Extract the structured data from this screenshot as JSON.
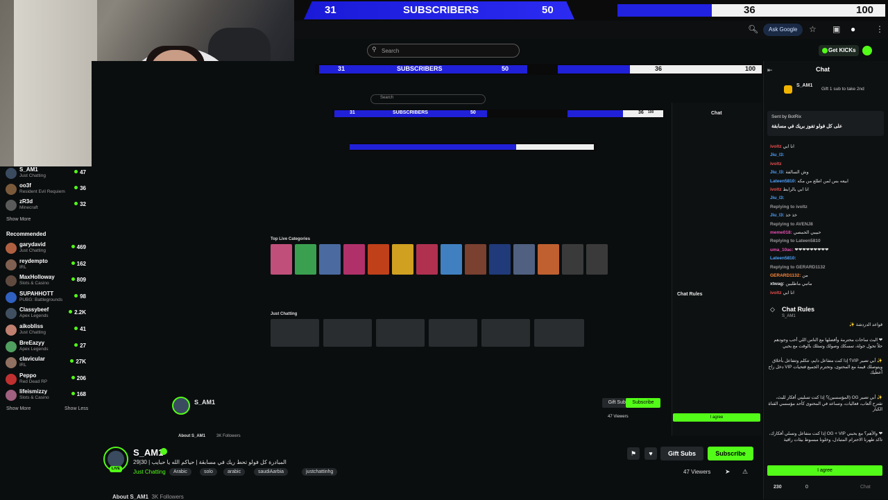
{
  "scoreboard": {
    "left_count": "31",
    "label": "SUBSCRIBERS",
    "target": "50",
    "right_label": "",
    "right_count": "36",
    "right_target": "100"
  },
  "browser": {
    "ask_google": "Ask Google"
  },
  "header": {
    "search_placeholder": "Search",
    "get_kicks": "Get KICKs"
  },
  "sidebar": {
    "followed": [
      {
        "name": "S_AM1",
        "game": "Just Chatting",
        "count": "47",
        "color": "#3a4b60"
      },
      {
        "name": "oo3f",
        "game": "Resident Evil Requiem",
        "count": "36",
        "color": "#7a5a3a"
      },
      {
        "name": "zR3d",
        "game": "Minecraft",
        "count": "32",
        "color": "#5a5a5a"
      }
    ],
    "show_more_1": "Show More",
    "recommended_title": "Recommended",
    "recommended": [
      {
        "name": "garydavid",
        "game": "Just Chatting",
        "count": "469",
        "color": "#b06040"
      },
      {
        "name": "reydempto",
        "game": "IRL",
        "count": "162",
        "color": "#806050"
      },
      {
        "name": "MaxHolloway",
        "game": "Slots & Casino",
        "count": "809",
        "color": "#604a40"
      },
      {
        "name": "SUPAHHOTT",
        "game": "PUBG: Battlegrounds",
        "count": "98",
        "color": "#3060c0"
      },
      {
        "name": "Classybeef",
        "game": "Apex Legends",
        "count": "2.2K",
        "color": "#405060"
      },
      {
        "name": "aikobliss",
        "game": "Just Chatting",
        "count": "41",
        "color": "#c08070"
      },
      {
        "name": "BreEazyy",
        "game": "Apex Legends",
        "count": "27",
        "color": "#50a060"
      },
      {
        "name": "clavicular",
        "game": "IRL",
        "count": "27K",
        "color": "#907060"
      },
      {
        "name": "Peppo",
        "game": "Red Dead RP",
        "count": "206",
        "color": "#c03030"
      },
      {
        "name": "lifeismizzy",
        "game": "Slots & Casino",
        "count": "168",
        "color": "#a06080"
      }
    ],
    "show_more_2": "Show More",
    "show_less": "Show Less"
  },
  "nested": {
    "l1_left": "31",
    "l1_label": "SUBSCRIBERS",
    "l1_target": "50",
    "l1_right_count": "36",
    "l1_right_target": "100",
    "l2_left": "31",
    "l2_label": "SUBSCRIBERS",
    "l2_target": "50",
    "l2_right_count": "36",
    "l2_right_target": "100",
    "top_live": "Top Live Categories",
    "just_chatting": "Just Chatting",
    "chat_rules": "Chat Rules",
    "channel_name": "S_AM1",
    "gift_subs": "Gift Subs",
    "subscribe": "Subscribe",
    "viewers": "47 Viewers",
    "agree": "I agree",
    "about": "About S_AM1",
    "followers": "3K Followers"
  },
  "channel": {
    "name": "S_AM1",
    "title": "29|30 | المبادرة كل فولو تحط ريك في مسابقة  | حياكم الله يا حبايب",
    "category": "Just Chatting",
    "tags": [
      "Arabic",
      "solo",
      "arabic",
      "saudiAarbia",
      "justchattinhg"
    ],
    "live": "LIVE",
    "gift_subs": "Gift Subs",
    "subscribe": "Subscribe",
    "viewers": "47 Viewers",
    "about": "About S_AM1",
    "followers": "3K Followers"
  },
  "chat": {
    "title": "Chat",
    "pinned_user": "S_AM1",
    "pinned_text": "Gift 1 sub to take 2nd",
    "bot_header": "Sent by BotRix",
    "bot_text": "على كل فولو تفوز بريك في مسابقة",
    "messages": [
      {
        "user": "ivoltz",
        "text": "انا ابي",
        "color": "#e94f4f"
      },
      {
        "user": "Jiu_l3:",
        "text": "",
        "color": "#4fa3ff"
      },
      {
        "user": "ivoltz",
        "text": "",
        "color": "#e94f4f"
      },
      {
        "user": "Jiu_l3:",
        "text": "وش السالفة",
        "color": "#4fa3ff"
      },
      {
        "user": "Lateen5810:",
        "text": "ابيعه بس لمن اطلع من مكه",
        "color": "#4fa3ff"
      },
      {
        "user": "ivoltz",
        "text": "انا ابي بالرابط",
        "color": "#e94f4f"
      },
      {
        "user": "Jiu_l3:",
        "text": "",
        "color": "#4fa3ff"
      },
      {
        "user": "Replying to ivoltz",
        "text": "",
        "color": "#999999"
      },
      {
        "user": "Jiu_l3:",
        "text": "خذ خذ",
        "color": "#4fa3ff"
      },
      {
        "user": "Replying to AVENJ8",
        "text": "",
        "color": "#999999"
      },
      {
        "user": "meme018:",
        "text": "حبيبي الحمصي",
        "color": "#e94fb4"
      },
      {
        "user": "Replying to Lateen5810",
        "text": "",
        "color": "#999999"
      },
      {
        "user": "uma_10ac:",
        "text": "❤❤❤❤❤❤❤❤❤",
        "color": "#e94fb4"
      },
      {
        "user": "Lateen5810:",
        "text": "",
        "color": "#4fa3ff"
      },
      {
        "user": "Replying to GERARD1132",
        "text": "",
        "color": "#999999"
      },
      {
        "user": "GERARD1132:",
        "text": "من",
        "color": "#ff8a3d"
      },
      {
        "user": "xtwag:",
        "text": "ماتبي ماطلبين",
        "color": "#e6e6e6"
      },
      {
        "user": "ivoltz",
        "text": "انا ابي",
        "color": "#e94f4f"
      }
    ],
    "rules_title": "Chat Rules",
    "rules_sub": "S_AM1",
    "rules": [
      "قواعد الدردشة ✨",
      "❤ البث ساحات محترمة وأفضلها مع الناس اللي أحب وجودهم حلاً تحول جولة، تمسكك وصولك وتمتلك بالوقت مع بحبي",
      "✨ أبي تصير VIP؟ إذا كنت متفاعل دايم، تتكلم وتتفاعل بأخلاق ويتوصلك قيمة مع المحتوى، وتحترم الجميع فتحيات VIP دخل راح أعطيك",
      "✨ أبي تصير OG (المؤسسين)؟ إذا كنت تسليني أفكار للبث، تقترح ألعاب، فعاليات، وتساعد في المحتوى كأحد مؤسسي القناة الكبار",
      "❤ والأهم؟ مع بحبني OG + VIP إذا كنت متفاعل وتسلي أفكارك، تاكد طهرنا الاحترام المتبادل، وخلونا مبسوط بيئات راقية"
    ],
    "agree": "I agree",
    "footer_points": "230",
    "footer_zero": "0",
    "chat_button": "Chat"
  },
  "colors": {
    "accent": "#53fc18",
    "blue_bar": "#2121e0",
    "background": "#0b0e0f"
  }
}
